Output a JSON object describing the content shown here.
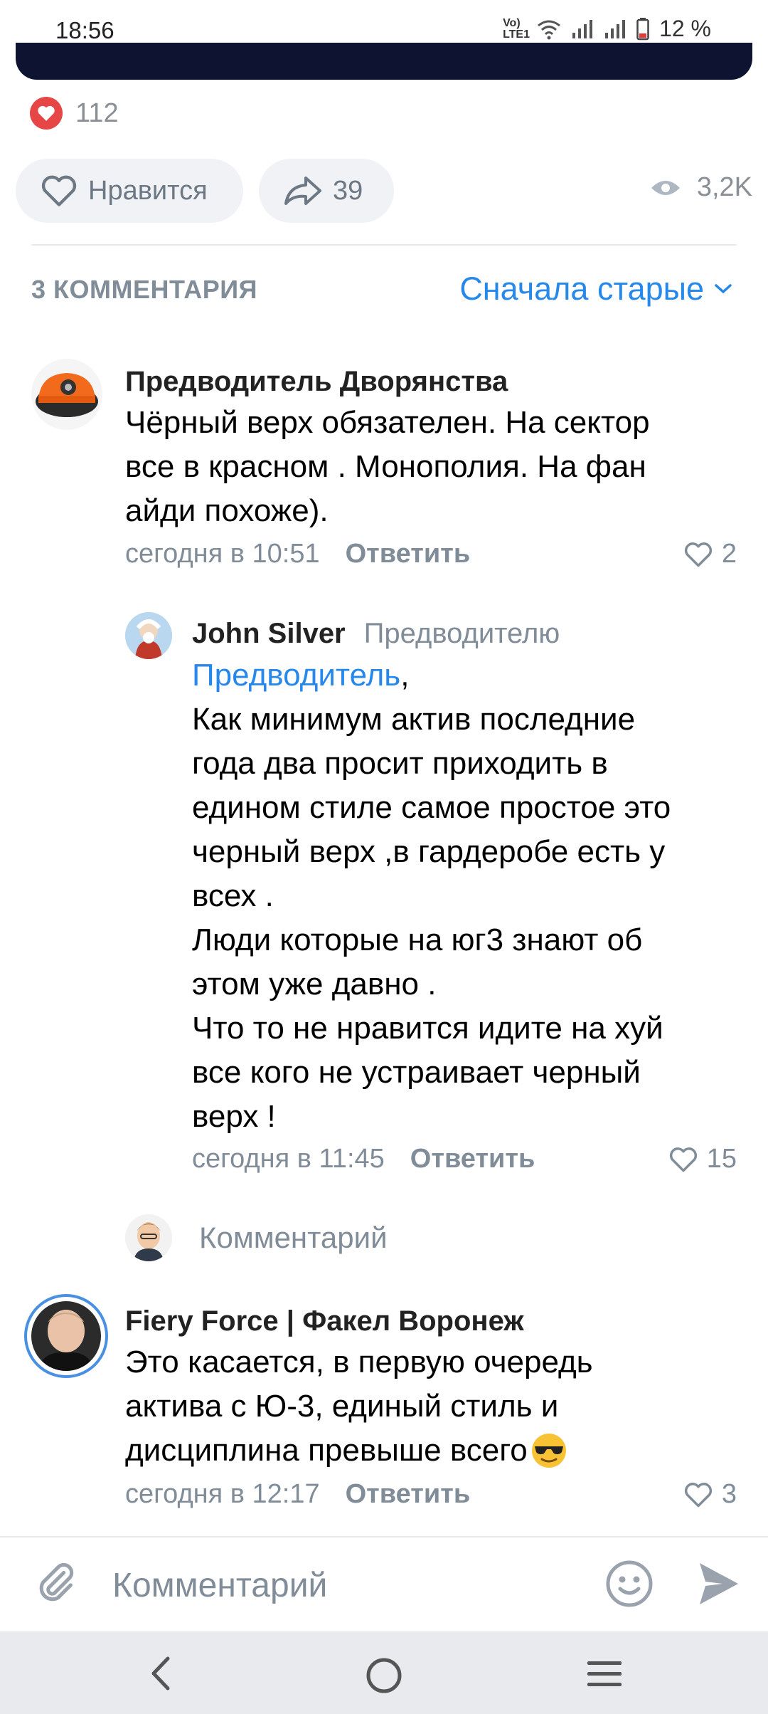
{
  "status_bar": {
    "time": "18:56",
    "network": "Vo) LTE1",
    "battery": "12 %"
  },
  "post": {
    "likes_count": "112",
    "like_label": "Нравится",
    "shares_count": "39",
    "views_count": "3,2K"
  },
  "comments_header": {
    "count_label": "3 КОММЕНТАРИЯ",
    "sort_label": "Сначала старые"
  },
  "comments": [
    {
      "author": "Предводитель Дворянства",
      "lines": [
        "Чёрный верх обязателен. На сектор",
        "все в красном . Монополия. На фан",
        "айди похоже)."
      ],
      "time": "сегодня в 10:51",
      "reply_label": "Ответить",
      "likes": "2"
    },
    {
      "author": "John Silver",
      "reply_to": "Предводителю",
      "mention": "Предводитель",
      "lines": [
        ",",
        "Как минимум актив последние",
        "года два просит приходить в",
        "едином стиле самое простое это",
        "черный верх ,в гардеробе есть у",
        "всех .",
        "Люди которые на юг3 знают об",
        "этом  уже давно .",
        "Что то не нравится идите на хуй",
        "все кого не устраивает черный",
        "верх !"
      ],
      "time": "сегодня в 11:45",
      "reply_label": "Ответить",
      "likes": "15"
    },
    {
      "author": "Fiery Force | Факел Воронеж",
      "lines": [
        "Это касается, в первую очередь",
        "актива с Ю-3, единый стиль и",
        "дисциплина превыше всего"
      ],
      "time": "сегодня в 12:17",
      "reply_label": "Ответить",
      "likes": "3"
    }
  ],
  "thread_reply": {
    "placeholder": "Комментарий"
  },
  "composer": {
    "placeholder": "Комментарий"
  },
  "icons": {
    "accent": "#2688eb",
    "heart_badge": "#e64646"
  }
}
